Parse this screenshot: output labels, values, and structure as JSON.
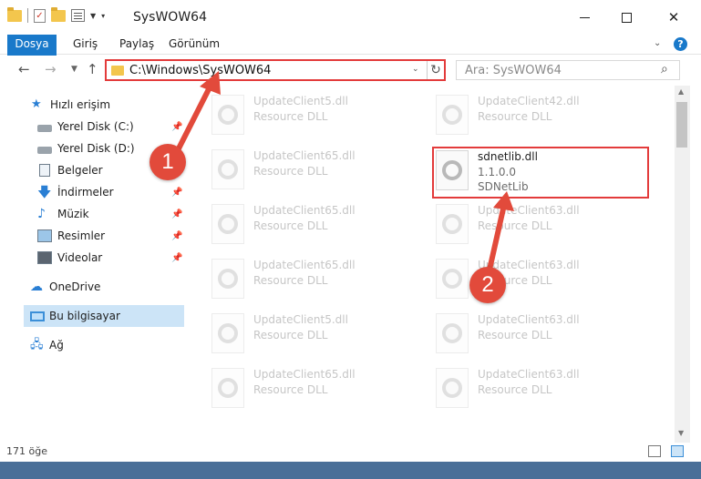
{
  "titlebar": {
    "title": "SysWOW64"
  },
  "ribbon": {
    "tabs": [
      "Dosya",
      "Giriş",
      "Paylaş",
      "Görünüm"
    ]
  },
  "address": {
    "path": "C:\\Windows\\SysWOW64",
    "search_placeholder": "Ara: SysWOW64"
  },
  "sidebar": {
    "items": [
      {
        "label": "Hızlı erişim",
        "icon": "star-icon"
      },
      {
        "label": "Yerel Disk (C:)",
        "icon": "drive-icon"
      },
      {
        "label": "Yerel Disk (D:)",
        "icon": "drive-icon"
      },
      {
        "label": "Belgeler",
        "icon": "document-icon"
      },
      {
        "label": "İndirmeler",
        "icon": "download-icon"
      },
      {
        "label": "Müzik",
        "icon": "music-icon"
      },
      {
        "label": "Resimler",
        "icon": "pictures-icon"
      },
      {
        "label": "Videolar",
        "icon": "video-icon"
      },
      {
        "label": "OneDrive",
        "icon": "cloud-icon"
      },
      {
        "label": "Bu bilgisayar",
        "icon": "computer-icon"
      },
      {
        "label": "Ağ",
        "icon": "network-icon"
      }
    ]
  },
  "files": [
    {
      "name": "UpdateClient5.dll",
      "type": "Resource DLL"
    },
    {
      "name": "UpdateClient42.dll",
      "type": "Resource DLL"
    },
    {
      "name": "UpdateClient65.dll",
      "type": "Resource DLL"
    },
    {
      "name": "sdnetlib.dll",
      "version": "1.1.0.0",
      "description": "SDNetLib"
    },
    {
      "name": "UpdateClient65.dll",
      "type": "Resource DLL"
    },
    {
      "name": "UpdateClient63.dll",
      "type": "Resource DLL"
    },
    {
      "name": "UpdateClient65.dll",
      "type": "Resource DLL"
    },
    {
      "name": "UpdateClient63.dll",
      "type": "Resource DLL"
    },
    {
      "name": "UpdateClient5.dll",
      "type": "Resource DLL"
    },
    {
      "name": "UpdateClient63.dll",
      "type": "Resource DLL"
    },
    {
      "name": "UpdateClient65.dll",
      "type": "Resource DLL"
    },
    {
      "name": "UpdateClient63.dll",
      "type": "Resource DLL"
    }
  ],
  "status": {
    "count": "171 öğe"
  },
  "annotations": {
    "step1": "1",
    "step2": "2",
    "color": "#e24a3b"
  }
}
